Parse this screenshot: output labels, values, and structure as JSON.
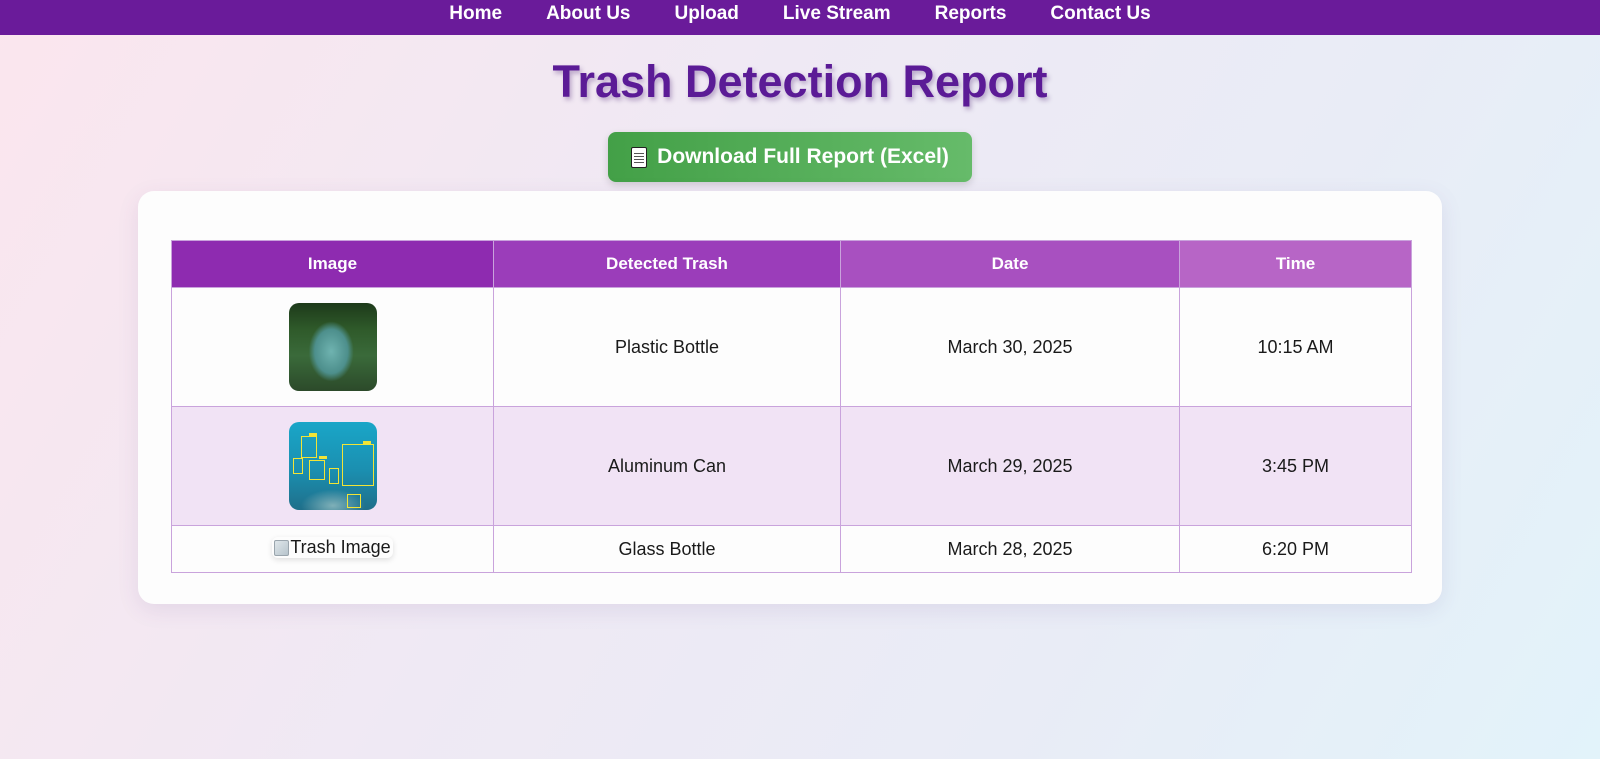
{
  "nav": {
    "items": [
      "Home",
      "About Us",
      "Upload",
      "Live Stream",
      "Reports",
      "Contact Us"
    ]
  },
  "page": {
    "title": "Trash Detection Report"
  },
  "download": {
    "icon": "document-icon",
    "label": "Download Full Report (Excel)"
  },
  "table": {
    "headers": [
      "Image",
      "Detected Trash",
      "Date",
      "Time"
    ],
    "rows": [
      {
        "image": "river-thumbnail",
        "trash": "Plastic Bottle",
        "date": "March 30, 2025",
        "time": "10:15 AM"
      },
      {
        "image": "underwater-detection-thumbnail",
        "trash": "Aluminum Can",
        "date": "March 29, 2025",
        "time": "3:45 PM"
      },
      {
        "image_alt": "Trash Image",
        "trash": "Glass Bottle",
        "date": "March 28, 2025",
        "time": "6:20 PM"
      }
    ]
  },
  "colors": {
    "nav_bg": "#6a1b9a",
    "title": "#5b1b96",
    "button_start": "#43a047",
    "button_end": "#66bb6a",
    "header_start": "#8e2bb0",
    "header_end": "#b765c6",
    "row_alt": "#f1e3f5"
  }
}
